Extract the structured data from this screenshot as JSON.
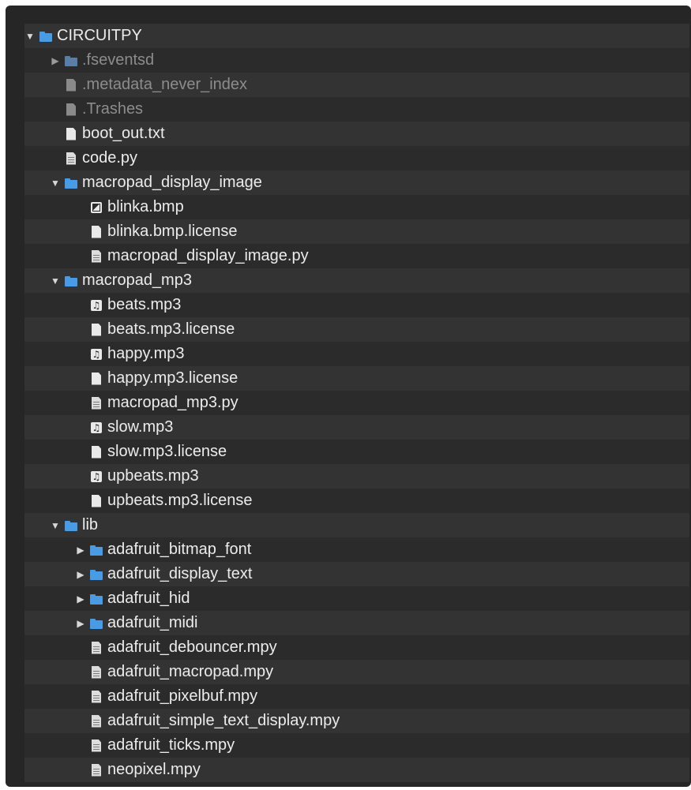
{
  "file_tree": [
    {
      "label": "CIRCUITPY",
      "indent": 0,
      "kind": "folder",
      "twisty": "expanded"
    },
    {
      "label": ".fseventsd",
      "indent": 1,
      "kind": "folder",
      "twisty": "collapsed",
      "dim": true
    },
    {
      "label": ".metadata_never_index",
      "indent": 1,
      "kind": "file",
      "dim": true
    },
    {
      "label": ".Trashes",
      "indent": 1,
      "kind": "file",
      "dim": true
    },
    {
      "label": "boot_out.txt",
      "indent": 1,
      "kind": "file"
    },
    {
      "label": "code.py",
      "indent": 1,
      "kind": "script"
    },
    {
      "label": "macropad_display_image",
      "indent": 1,
      "kind": "folder",
      "twisty": "expanded"
    },
    {
      "label": "blinka.bmp",
      "indent": 2,
      "kind": "image"
    },
    {
      "label": "blinka.bmp.license",
      "indent": 2,
      "kind": "file"
    },
    {
      "label": "macropad_display_image.py",
      "indent": 2,
      "kind": "script"
    },
    {
      "label": "macropad_mp3",
      "indent": 1,
      "kind": "folder",
      "twisty": "expanded"
    },
    {
      "label": "beats.mp3",
      "indent": 2,
      "kind": "audio"
    },
    {
      "label": "beats.mp3.license",
      "indent": 2,
      "kind": "file"
    },
    {
      "label": "happy.mp3",
      "indent": 2,
      "kind": "audio"
    },
    {
      "label": "happy.mp3.license",
      "indent": 2,
      "kind": "file"
    },
    {
      "label": "macropad_mp3.py",
      "indent": 2,
      "kind": "script"
    },
    {
      "label": "slow.mp3",
      "indent": 2,
      "kind": "audio"
    },
    {
      "label": "slow.mp3.license",
      "indent": 2,
      "kind": "file"
    },
    {
      "label": "upbeats.mp3",
      "indent": 2,
      "kind": "audio"
    },
    {
      "label": "upbeats.mp3.license",
      "indent": 2,
      "kind": "file"
    },
    {
      "label": "lib",
      "indent": 1,
      "kind": "folder",
      "twisty": "expanded"
    },
    {
      "label": "adafruit_bitmap_font",
      "indent": 2,
      "kind": "folder",
      "twisty": "collapsed"
    },
    {
      "label": "adafruit_display_text",
      "indent": 2,
      "kind": "folder",
      "twisty": "collapsed"
    },
    {
      "label": "adafruit_hid",
      "indent": 2,
      "kind": "folder",
      "twisty": "collapsed"
    },
    {
      "label": "adafruit_midi",
      "indent": 2,
      "kind": "folder",
      "twisty": "collapsed"
    },
    {
      "label": "adafruit_debouncer.mpy",
      "indent": 2,
      "kind": "script"
    },
    {
      "label": "adafruit_macropad.mpy",
      "indent": 2,
      "kind": "script"
    },
    {
      "label": "adafruit_pixelbuf.mpy",
      "indent": 2,
      "kind": "script"
    },
    {
      "label": "adafruit_simple_text_display.mpy",
      "indent": 2,
      "kind": "script"
    },
    {
      "label": "adafruit_ticks.mpy",
      "indent": 2,
      "kind": "script"
    },
    {
      "label": "neopixel.mpy",
      "indent": 2,
      "kind": "script"
    }
  ],
  "icons": {
    "folder": "folder-icon",
    "file": "file-icon",
    "script": "script-file-icon",
    "audio": "audio-file-icon",
    "image": "image-file-icon"
  },
  "colors": {
    "panel_background": "#262626",
    "row_odd": "#333333",
    "row_even": "#2b2b2b",
    "text": "#ececec",
    "dimmed_text": "#8c8c8c",
    "folder_accent": "#4a9be6"
  }
}
